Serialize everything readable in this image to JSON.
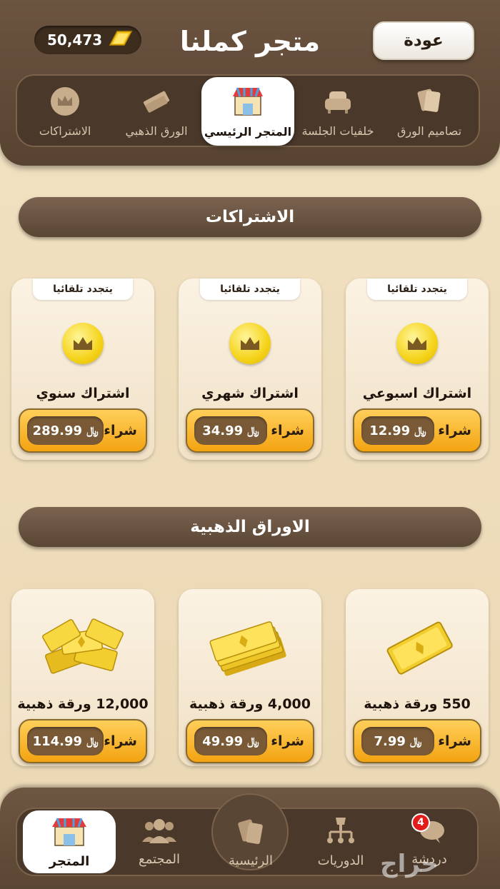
{
  "header": {
    "back_label": "عودة",
    "title": "متجر كملنا",
    "balance": "50,473"
  },
  "tabs": [
    {
      "label": "تصاميم الورق",
      "icon": "cards-icon"
    },
    {
      "label": "خلفيات الجلسة",
      "icon": "sofa-icon"
    },
    {
      "label": "المتجر الرئيسي",
      "icon": "shop-icon",
      "active": true
    },
    {
      "label": "الورق الذهبي",
      "icon": "gold-cards-icon"
    },
    {
      "label": "الاشتراكات",
      "icon": "crown-icon"
    }
  ],
  "subscriptions": {
    "title": "الاشتراكات",
    "items": [
      {
        "tag": "يتجدد تلقائيا",
        "name": "اشتراك اسبوعي",
        "buy": "شراء",
        "price": "12.99",
        "currency": "﷼"
      },
      {
        "tag": "يتجدد تلقائيا",
        "name": "اشتراك شهري",
        "buy": "شراء",
        "price": "34.99",
        "currency": "﷼"
      },
      {
        "tag": "يتجدد تلقائيا",
        "name": "اشتراك سنوي",
        "buy": "شراء",
        "price": "289.99",
        "currency": "﷼"
      }
    ]
  },
  "gold": {
    "title": "الاوراق الذهبية",
    "items": [
      {
        "name": "550 ورقة ذهبية",
        "buy": "شراء",
        "price": "7.99",
        "currency": "﷼"
      },
      {
        "name": "4,000 ورقة ذهبية",
        "buy": "شراء",
        "price": "49.99",
        "currency": "﷼"
      },
      {
        "name": "12,000 ورقة ذهبية",
        "buy": "شراء",
        "price": "114.99",
        "currency": "﷼"
      }
    ]
  },
  "bottom_nav": {
    "items": [
      {
        "label": "دردشة",
        "icon": "chat-icon",
        "badge": "4"
      },
      {
        "label": "الدوريات",
        "icon": "tournament-icon"
      },
      {
        "label": "الرئيسية",
        "icon": "home-cards-icon"
      },
      {
        "label": "المجتمع",
        "icon": "community-icon"
      },
      {
        "label": "المتجر",
        "icon": "shop-icon",
        "active": true
      }
    ]
  },
  "watermark": "حراج",
  "colors": {
    "accent": "#f3a311",
    "header": "#5e4836",
    "background": "#eedcb9"
  }
}
